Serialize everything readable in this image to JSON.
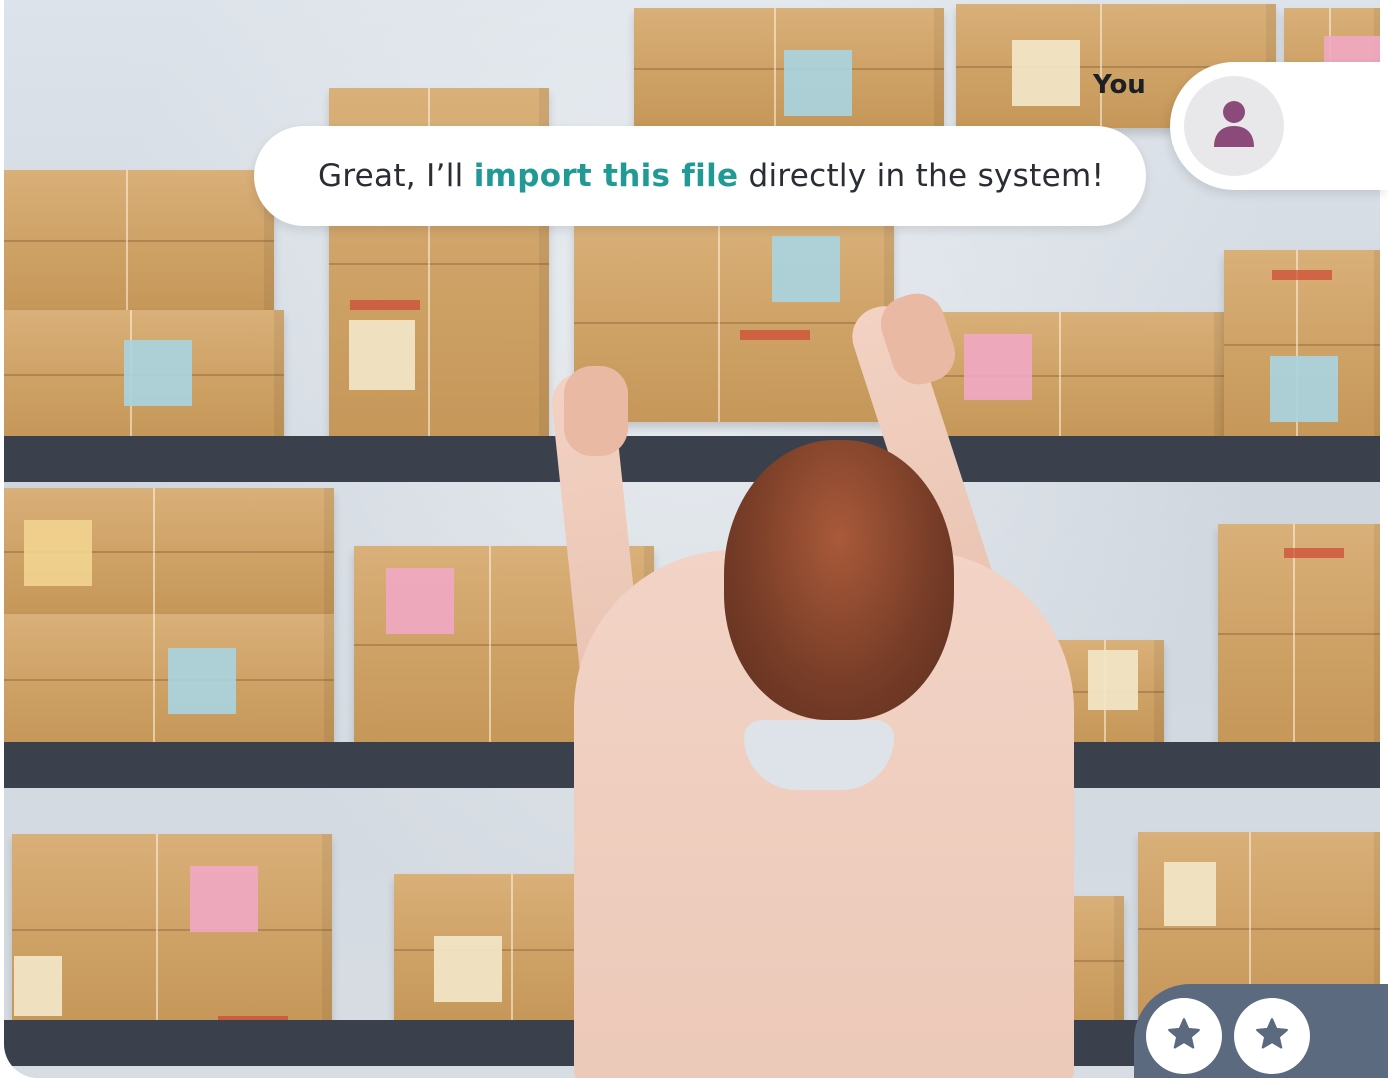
{
  "chat": {
    "sender_label": "You",
    "message_prefix": "Great, I’ll ",
    "message_highlight": "import this file",
    "message_suffix": " directly in the system!"
  },
  "avatar": {
    "icon": "user-icon",
    "color": "#8c4a7a"
  },
  "rating_buttons": [
    {
      "icon": "star-icon"
    },
    {
      "icon": "star-icon"
    }
  ],
  "colors": {
    "highlight": "#219a96",
    "rate_tab": "#5c6a80",
    "star": "#5c6a80"
  }
}
